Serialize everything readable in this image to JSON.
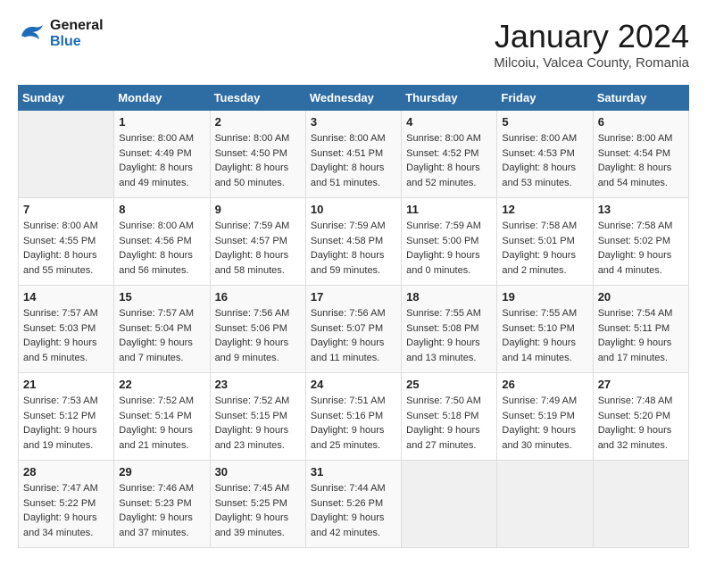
{
  "logo": {
    "text_general": "General",
    "text_blue": "Blue"
  },
  "title": "January 2024",
  "location": "Milcoiu, Valcea County, Romania",
  "days_of_week": [
    "Sunday",
    "Monday",
    "Tuesday",
    "Wednesday",
    "Thursday",
    "Friday",
    "Saturday"
  ],
  "weeks": [
    [
      {
        "day": "",
        "info": ""
      },
      {
        "day": "1",
        "sunrise": "Sunrise: 8:00 AM",
        "sunset": "Sunset: 4:49 PM",
        "daylight": "Daylight: 8 hours and 49 minutes."
      },
      {
        "day": "2",
        "sunrise": "Sunrise: 8:00 AM",
        "sunset": "Sunset: 4:50 PM",
        "daylight": "Daylight: 8 hours and 50 minutes."
      },
      {
        "day": "3",
        "sunrise": "Sunrise: 8:00 AM",
        "sunset": "Sunset: 4:51 PM",
        "daylight": "Daylight: 8 hours and 51 minutes."
      },
      {
        "day": "4",
        "sunrise": "Sunrise: 8:00 AM",
        "sunset": "Sunset: 4:52 PM",
        "daylight": "Daylight: 8 hours and 52 minutes."
      },
      {
        "day": "5",
        "sunrise": "Sunrise: 8:00 AM",
        "sunset": "Sunset: 4:53 PM",
        "daylight": "Daylight: 8 hours and 53 minutes."
      },
      {
        "day": "6",
        "sunrise": "Sunrise: 8:00 AM",
        "sunset": "Sunset: 4:54 PM",
        "daylight": "Daylight: 8 hours and 54 minutes."
      }
    ],
    [
      {
        "day": "7",
        "sunrise": "Sunrise: 8:00 AM",
        "sunset": "Sunset: 4:55 PM",
        "daylight": "Daylight: 8 hours and 55 minutes."
      },
      {
        "day": "8",
        "sunrise": "Sunrise: 8:00 AM",
        "sunset": "Sunset: 4:56 PM",
        "daylight": "Daylight: 8 hours and 56 minutes."
      },
      {
        "day": "9",
        "sunrise": "Sunrise: 7:59 AM",
        "sunset": "Sunset: 4:57 PM",
        "daylight": "Daylight: 8 hours and 58 minutes."
      },
      {
        "day": "10",
        "sunrise": "Sunrise: 7:59 AM",
        "sunset": "Sunset: 4:58 PM",
        "daylight": "Daylight: 8 hours and 59 minutes."
      },
      {
        "day": "11",
        "sunrise": "Sunrise: 7:59 AM",
        "sunset": "Sunset: 5:00 PM",
        "daylight": "Daylight: 9 hours and 0 minutes."
      },
      {
        "day": "12",
        "sunrise": "Sunrise: 7:58 AM",
        "sunset": "Sunset: 5:01 PM",
        "daylight": "Daylight: 9 hours and 2 minutes."
      },
      {
        "day": "13",
        "sunrise": "Sunrise: 7:58 AM",
        "sunset": "Sunset: 5:02 PM",
        "daylight": "Daylight: 9 hours and 4 minutes."
      }
    ],
    [
      {
        "day": "14",
        "sunrise": "Sunrise: 7:57 AM",
        "sunset": "Sunset: 5:03 PM",
        "daylight": "Daylight: 9 hours and 5 minutes."
      },
      {
        "day": "15",
        "sunrise": "Sunrise: 7:57 AM",
        "sunset": "Sunset: 5:04 PM",
        "daylight": "Daylight: 9 hours and 7 minutes."
      },
      {
        "day": "16",
        "sunrise": "Sunrise: 7:56 AM",
        "sunset": "Sunset: 5:06 PM",
        "daylight": "Daylight: 9 hours and 9 minutes."
      },
      {
        "day": "17",
        "sunrise": "Sunrise: 7:56 AM",
        "sunset": "Sunset: 5:07 PM",
        "daylight": "Daylight: 9 hours and 11 minutes."
      },
      {
        "day": "18",
        "sunrise": "Sunrise: 7:55 AM",
        "sunset": "Sunset: 5:08 PM",
        "daylight": "Daylight: 9 hours and 13 minutes."
      },
      {
        "day": "19",
        "sunrise": "Sunrise: 7:55 AM",
        "sunset": "Sunset: 5:10 PM",
        "daylight": "Daylight: 9 hours and 14 minutes."
      },
      {
        "day": "20",
        "sunrise": "Sunrise: 7:54 AM",
        "sunset": "Sunset: 5:11 PM",
        "daylight": "Daylight: 9 hours and 17 minutes."
      }
    ],
    [
      {
        "day": "21",
        "sunrise": "Sunrise: 7:53 AM",
        "sunset": "Sunset: 5:12 PM",
        "daylight": "Daylight: 9 hours and 19 minutes."
      },
      {
        "day": "22",
        "sunrise": "Sunrise: 7:52 AM",
        "sunset": "Sunset: 5:14 PM",
        "daylight": "Daylight: 9 hours and 21 minutes."
      },
      {
        "day": "23",
        "sunrise": "Sunrise: 7:52 AM",
        "sunset": "Sunset: 5:15 PM",
        "daylight": "Daylight: 9 hours and 23 minutes."
      },
      {
        "day": "24",
        "sunrise": "Sunrise: 7:51 AM",
        "sunset": "Sunset: 5:16 PM",
        "daylight": "Daylight: 9 hours and 25 minutes."
      },
      {
        "day": "25",
        "sunrise": "Sunrise: 7:50 AM",
        "sunset": "Sunset: 5:18 PM",
        "daylight": "Daylight: 9 hours and 27 minutes."
      },
      {
        "day": "26",
        "sunrise": "Sunrise: 7:49 AM",
        "sunset": "Sunset: 5:19 PM",
        "daylight": "Daylight: 9 hours and 30 minutes."
      },
      {
        "day": "27",
        "sunrise": "Sunrise: 7:48 AM",
        "sunset": "Sunset: 5:20 PM",
        "daylight": "Daylight: 9 hours and 32 minutes."
      }
    ],
    [
      {
        "day": "28",
        "sunrise": "Sunrise: 7:47 AM",
        "sunset": "Sunset: 5:22 PM",
        "daylight": "Daylight: 9 hours and 34 minutes."
      },
      {
        "day": "29",
        "sunrise": "Sunrise: 7:46 AM",
        "sunset": "Sunset: 5:23 PM",
        "daylight": "Daylight: 9 hours and 37 minutes."
      },
      {
        "day": "30",
        "sunrise": "Sunrise: 7:45 AM",
        "sunset": "Sunset: 5:25 PM",
        "daylight": "Daylight: 9 hours and 39 minutes."
      },
      {
        "day": "31",
        "sunrise": "Sunrise: 7:44 AM",
        "sunset": "Sunset: 5:26 PM",
        "daylight": "Daylight: 9 hours and 42 minutes."
      },
      {
        "day": "",
        "info": ""
      },
      {
        "day": "",
        "info": ""
      },
      {
        "day": "",
        "info": ""
      }
    ]
  ]
}
